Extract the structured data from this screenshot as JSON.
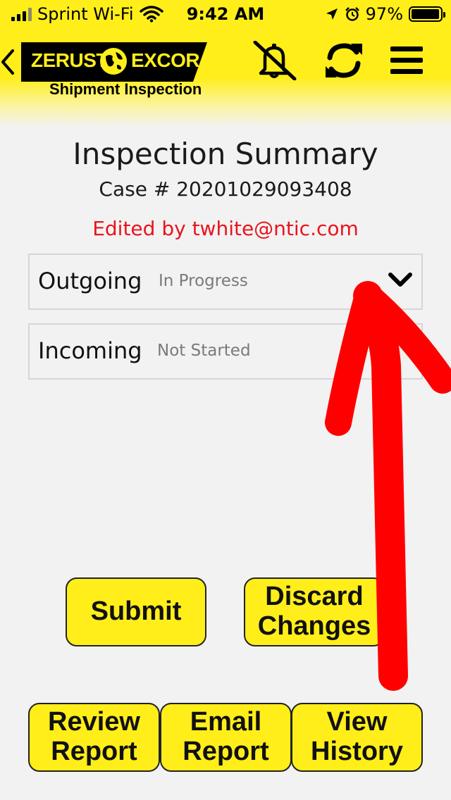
{
  "status_bar": {
    "carrier": "Sprint Wi-Fi",
    "time": "9:42 AM",
    "battery": "97%",
    "battery_level": 0.97,
    "icons": [
      "signal-icon",
      "wifi-icon",
      "location-icon",
      "alarm-icon",
      "battery-icon"
    ]
  },
  "header": {
    "logo_left": "ZERUST",
    "logo_right": "EXCOR",
    "logo_subtitle": "Shipment Inspection",
    "icons": [
      "back-icon",
      "bell-off-icon",
      "refresh-icon",
      "menu-icon"
    ]
  },
  "summary": {
    "title": "Inspection Summary",
    "case_line": "Case # 20201029093408",
    "edited_by": "Edited by twhite@ntic.com"
  },
  "sections": [
    {
      "name": "Outgoing",
      "status": "In Progress",
      "expanded": true
    },
    {
      "name": "Incoming",
      "status": "Not Started",
      "expanded": false
    }
  ],
  "actions": {
    "submit": "Submit",
    "discard_line1": "Discard",
    "discard_line2": "Changes",
    "review_line1": "Review",
    "review_line2": "Report",
    "email_line1": "Email",
    "email_line2": "Report",
    "history_line1": "View",
    "history_line2": "History"
  },
  "colors": {
    "brand_yellow": "#ffee1a",
    "edited_red": "#e8141e",
    "annotation_red": "#ff0000"
  }
}
